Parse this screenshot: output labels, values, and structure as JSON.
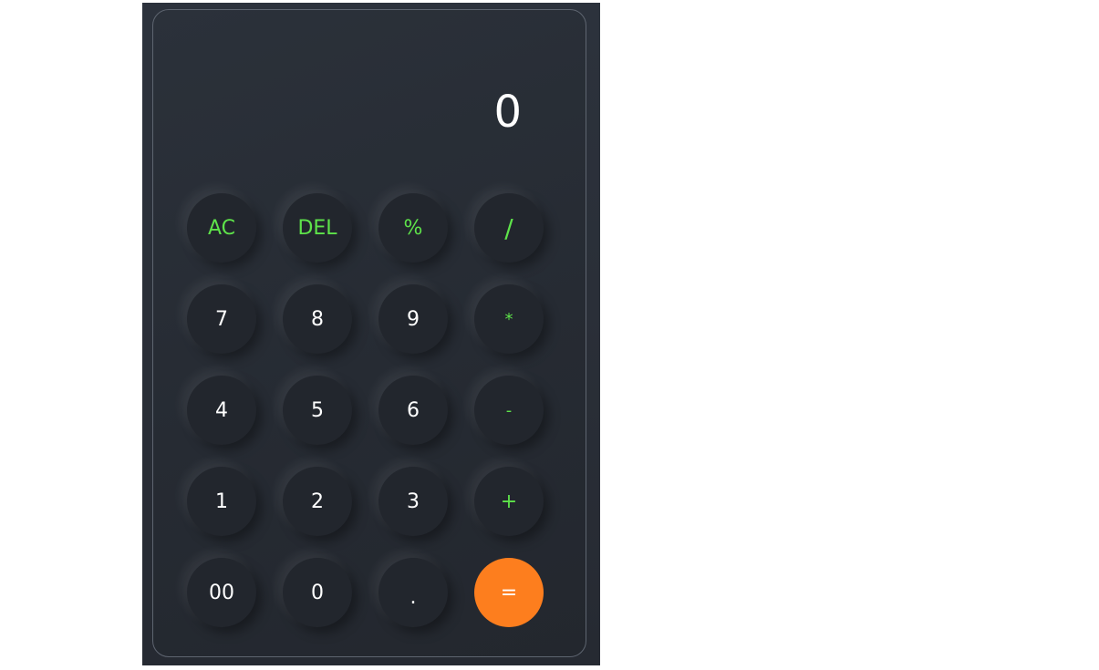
{
  "display": {
    "value": "0"
  },
  "keys": {
    "ac": "AC",
    "del": "DEL",
    "percent": "%",
    "divide": "/",
    "seven": "7",
    "eight": "8",
    "nine": "9",
    "multiply": "*",
    "four": "4",
    "five": "5",
    "six": "6",
    "minus": "-",
    "one": "1",
    "two": "2",
    "three": "3",
    "plus": "+",
    "double_zero": "00",
    "zero": "0",
    "dot": ".",
    "equals": "="
  },
  "colors": {
    "operator": "#5ee34a",
    "equals": "#fd7e1e",
    "background": "#262b33"
  }
}
